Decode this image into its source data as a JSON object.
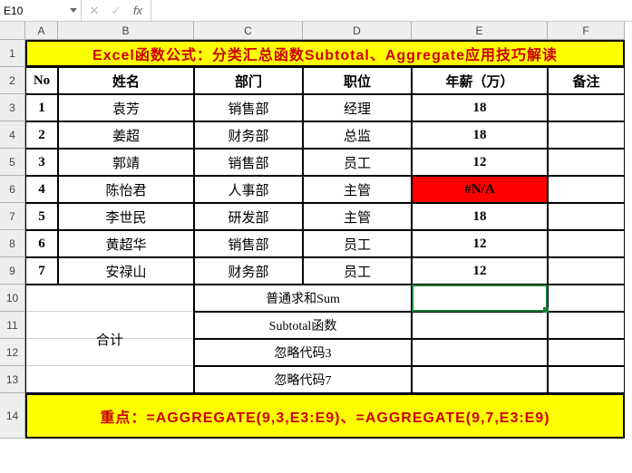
{
  "nameBox": "E10",
  "formula": "",
  "columns": [
    "A",
    "B",
    "C",
    "D",
    "E",
    "F"
  ],
  "rowNumbers": [
    "1",
    "2",
    "3",
    "4",
    "5",
    "6",
    "7",
    "8",
    "9",
    "10",
    "11",
    "12",
    "13",
    "14"
  ],
  "title": "Excel函数公式：分类汇总函数Subtotal、Aggregate应用技巧解读",
  "headers": {
    "no": "No",
    "name": "姓名",
    "dept": "部门",
    "pos": "职位",
    "salary": "年薪（万）",
    "note": "备注"
  },
  "rows": [
    {
      "no": "1",
      "name": "袁芳",
      "dept": "销售部",
      "pos": "经理",
      "salary": "18",
      "note": ""
    },
    {
      "no": "2",
      "name": "姜超",
      "dept": "财务部",
      "pos": "总监",
      "salary": "18",
      "note": ""
    },
    {
      "no": "3",
      "name": "郭靖",
      "dept": "销售部",
      "pos": "员工",
      "salary": "12",
      "note": ""
    },
    {
      "no": "4",
      "name": "陈怡君",
      "dept": "人事部",
      "pos": "主管",
      "salary": "#N/A",
      "note": ""
    },
    {
      "no": "5",
      "name": "李世民",
      "dept": "研发部",
      "pos": "主管",
      "salary": "18",
      "note": ""
    },
    {
      "no": "6",
      "name": "黄超华",
      "dept": "销售部",
      "pos": "员工",
      "salary": "12",
      "note": ""
    },
    {
      "no": "7",
      "name": "安禄山",
      "dept": "财务部",
      "pos": "员工",
      "salary": "12",
      "note": ""
    }
  ],
  "totals": {
    "label": "合计",
    "items": [
      "普通求和Sum",
      "Subtotal函数",
      "忽略代码3",
      "忽略代码7"
    ]
  },
  "footer": "重点：=AGGREGATE(9,3,E3:E9)、=AGGREGATE(9,7,E3:E9)",
  "chart_data": {
    "type": "table",
    "title": "Excel函数公式：分类汇总函数Subtotal、Aggregate应用技巧解读",
    "columns": [
      "No",
      "姓名",
      "部门",
      "职位",
      "年薪（万）",
      "备注"
    ],
    "rows": [
      [
        "1",
        "袁芳",
        "销售部",
        "经理",
        18,
        ""
      ],
      [
        "2",
        "姜超",
        "财务部",
        "总监",
        18,
        ""
      ],
      [
        "3",
        "郭靖",
        "销售部",
        "员工",
        12,
        ""
      ],
      [
        "4",
        "陈怡君",
        "人事部",
        "主管",
        "#N/A",
        ""
      ],
      [
        "5",
        "李世民",
        "研发部",
        "主管",
        18,
        ""
      ],
      [
        "6",
        "黄超华",
        "销售部",
        "员工",
        12,
        ""
      ],
      [
        "7",
        "安禄山",
        "财务部",
        "员工",
        12,
        ""
      ]
    ],
    "footer": "重点：=AGGREGATE(9,3,E3:E9)、=AGGREGATE(9,7,E3:E9)"
  }
}
